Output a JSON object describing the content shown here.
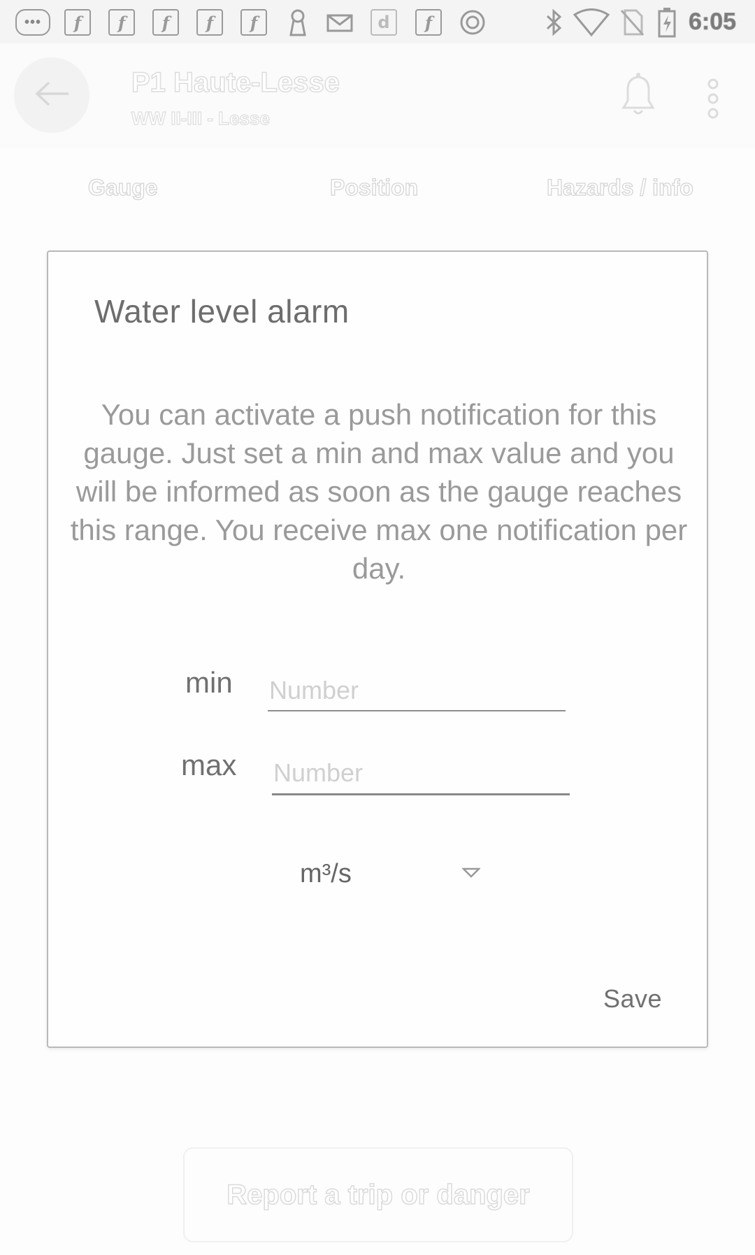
{
  "status_bar": {
    "time": "6:05",
    "left_icons": [
      "more-notifications-icon",
      "facebook-icon",
      "facebook-icon",
      "facebook-icon",
      "facebook-icon",
      "facebook-icon",
      "keyhole-icon",
      "mail-icon",
      "d-app-icon",
      "facebook-icon",
      "circle-app-icon"
    ],
    "right_icons": [
      "bluetooth-icon",
      "wifi-icon",
      "no-sim-icon",
      "battery-charging-icon"
    ]
  },
  "app_bar": {
    "title": "P1 Haute-Lesse",
    "subtitle": "WW II-III - Lesse"
  },
  "tabs": [
    {
      "label": "Gauge"
    },
    {
      "label": "Position"
    },
    {
      "label": "Hazards / info"
    }
  ],
  "dialog": {
    "title": "Water level alarm",
    "body": "You can activate a push notification for this gauge. Just set a min and max value and you will be informed as soon as the gauge reaches this range. You receive max one notification per day.",
    "min_label": "min",
    "min_value": "",
    "min_placeholder": "Number",
    "max_label": "max",
    "max_value": "",
    "max_placeholder": "Number",
    "unit": "m³/s",
    "save_label": "Save"
  },
  "report_button": {
    "label": "Report a trip or danger"
  }
}
